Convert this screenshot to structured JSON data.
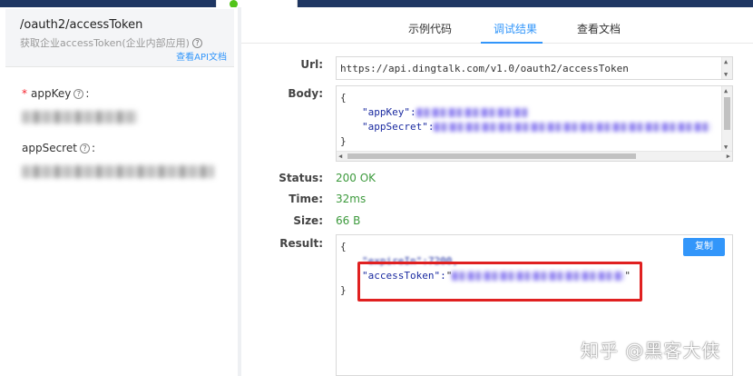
{
  "toast": {
    "status": "success"
  },
  "left": {
    "api_path": "/oauth2/accessToken",
    "api_desc": "获取企业accessToken(企业内部应用)",
    "api_doc_link": "查看API文档",
    "fields": [
      {
        "label": "appKey",
        "required": true
      },
      {
        "label": "appSecret",
        "required": false
      }
    ]
  },
  "tabs": [
    "示例代码",
    "调试结果",
    "查看文档"
  ],
  "active_tab": "调试结果",
  "labels": {
    "url": "Url:",
    "body": "Body:",
    "status": "Status:",
    "time": "Time:",
    "size": "Size:",
    "result": "Result:"
  },
  "request": {
    "url": "https://api.dingtalk.com/v1.0/oauth2/accessToken",
    "body_open": "{",
    "body_key1": "\"appKey\":",
    "body_key2": "\"appSecret\":",
    "body_close": "}"
  },
  "response": {
    "status": "200 OK",
    "time": "32ms",
    "size": "66 B",
    "open": "{",
    "expire_key": "\"expireIn\":7200,",
    "token_key": "\"accessToken\":",
    "token_quote": "\"",
    "close": "}",
    "copy_label": "复制"
  },
  "colors": {
    "accent": "#3296fa",
    "success": "#3d9a3d",
    "highlight_box": "#e02020"
  },
  "watermark": "知乎 @黑客大侠"
}
